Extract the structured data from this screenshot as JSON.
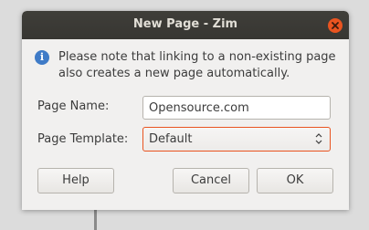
{
  "window": {
    "title": "New Page - Zim"
  },
  "info": {
    "icon": "info-icon",
    "message": "Please note that linking to a non-existing page also creates a new page automatically."
  },
  "form": {
    "page_name_label": "Page Name:",
    "page_name_value": "Opensource.com",
    "page_template_label": "Page Template:",
    "page_template_value": "Default"
  },
  "buttons": {
    "help": "Help",
    "cancel": "Cancel",
    "ok": "OK"
  },
  "colors": {
    "titlebar": "#3c3b37",
    "close": "#e95420",
    "focus_border": "#e95420",
    "info_icon": "#3f7bc7"
  }
}
